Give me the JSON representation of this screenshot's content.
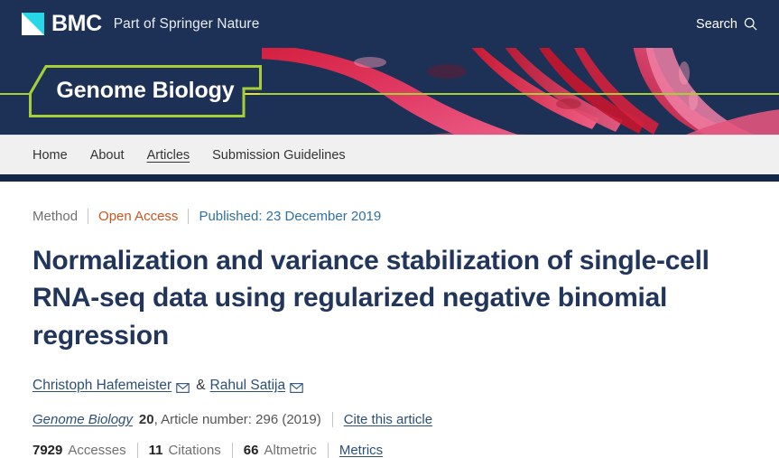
{
  "brandbar": {
    "logo_icon": "bmc-logo-icon",
    "logo_word": "BMC",
    "tagline": "Part of Springer Nature",
    "search_label": "Search",
    "search_icon": "search-icon",
    "background_color": "#1d3055"
  },
  "banner": {
    "journal_name": "Genome Biology",
    "accent_color": "#a6ce39",
    "rule_color": "#e8e22a",
    "background_color": "#1d3055",
    "artwork": "dna-helix-illustration"
  },
  "nav": {
    "items": [
      {
        "label": "Home",
        "active": false
      },
      {
        "label": "About",
        "active": false
      },
      {
        "label": "Articles",
        "active": true
      },
      {
        "label": "Submission Guidelines",
        "active": false
      }
    ]
  },
  "article": {
    "meta": {
      "type": "Method",
      "access": "Open Access",
      "published": "Published: 23 December 2019",
      "access_color": "#c85520",
      "published_color": "#31709e"
    },
    "title": "Normalization and variance stabilization of single-cell RNA-seq data using regularized negative binomial regression",
    "authors": [
      {
        "name": "Christoph Hafemeister",
        "email_icon": "envelope-icon"
      },
      {
        "name": "Rahul Satija",
        "email_icon": "envelope-icon"
      }
    ],
    "author_conjunction": "&",
    "citation": {
      "journal": "Genome Biology",
      "volume": "20",
      "rest": ", Article number: 296 (2019)",
      "cite_link": "Cite this article"
    },
    "metrics": [
      {
        "value": "7929",
        "label": "Accesses"
      },
      {
        "value": "11",
        "label": "Citations"
      },
      {
        "value": "66",
        "label": "Altmetric"
      }
    ],
    "metrics_link": "Metrics"
  }
}
